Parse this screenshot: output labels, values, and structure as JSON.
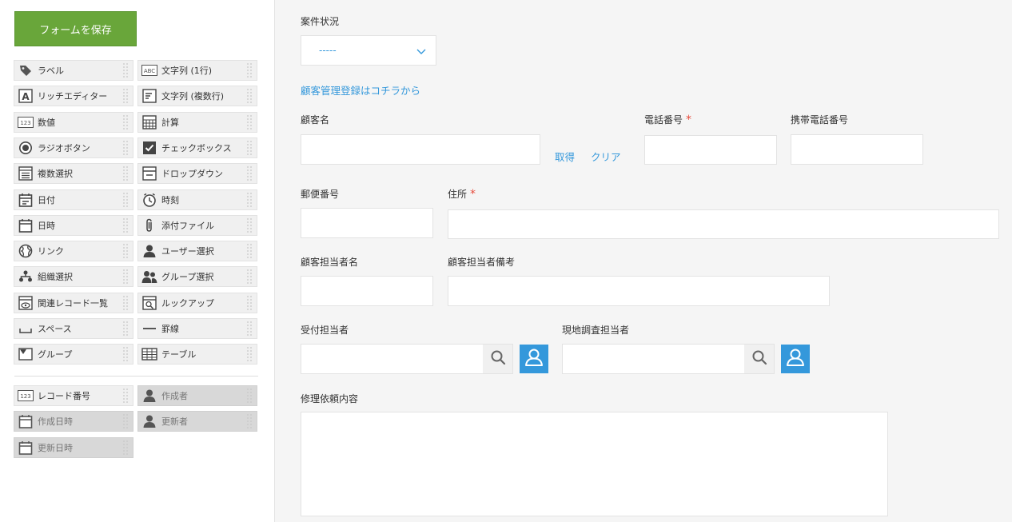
{
  "palette": {
    "save_label": "フォームを保存",
    "items": [
      {
        "label": "ラベル",
        "icon": "tag-icon"
      },
      {
        "label": "文字列 (1行)",
        "icon": "abc-text-icon"
      },
      {
        "label": "リッチエディター",
        "icon": "rich-editor-icon"
      },
      {
        "label": "文字列 (複数行)",
        "icon": "multiline-text-icon"
      },
      {
        "label": "数値",
        "icon": "number-icon"
      },
      {
        "label": "計算",
        "icon": "calculator-icon"
      },
      {
        "label": "ラジオボタン",
        "icon": "radio-button-icon"
      },
      {
        "label": "チェックボックス",
        "icon": "checkbox-icon"
      },
      {
        "label": "複数選択",
        "icon": "multi-select-icon"
      },
      {
        "label": "ドロップダウン",
        "icon": "dropdown-icon"
      },
      {
        "label": "日付",
        "icon": "date-icon"
      },
      {
        "label": "時刻",
        "icon": "clock-icon"
      },
      {
        "label": "日時",
        "icon": "datetime-icon"
      },
      {
        "label": "添付ファイル",
        "icon": "paperclip-icon"
      },
      {
        "label": "リンク",
        "icon": "globe-icon"
      },
      {
        "label": "ユーザー選択",
        "icon": "user-icon"
      },
      {
        "label": "組織選択",
        "icon": "org-icon"
      },
      {
        "label": "グループ選択",
        "icon": "group-icon"
      },
      {
        "label": "関連レコード一覧",
        "icon": "related-records-icon"
      },
      {
        "label": "ルックアップ",
        "icon": "lookup-icon"
      },
      {
        "label": "スペース",
        "icon": "space-icon"
      },
      {
        "label": "罫線",
        "icon": "line-icon"
      },
      {
        "label": "グループ",
        "icon": "group-field-icon"
      },
      {
        "label": "テーブル",
        "icon": "table-icon"
      }
    ],
    "system_items": [
      {
        "label": "レコード番号",
        "icon": "record-number-icon",
        "disabled": false
      },
      {
        "label": "作成者",
        "icon": "creator-icon",
        "disabled": true
      },
      {
        "label": "作成日時",
        "icon": "created-datetime-icon",
        "disabled": true
      },
      {
        "label": "更新者",
        "icon": "updater-icon",
        "disabled": true
      },
      {
        "label": "更新日時",
        "icon": "updated-datetime-icon",
        "disabled": true
      }
    ]
  },
  "form": {
    "status_label": "案件状況",
    "status_value": "-----",
    "customer_link": "顧客管理登録はコチラから",
    "customer_name_label": "顧客名",
    "get_link": "取得",
    "clear_link": "クリア",
    "phone_label": "電話番号",
    "mobile_label": "携帯電話番号",
    "postal_label": "郵便番号",
    "address_label": "住所",
    "contact_name_label": "顧客担当者名",
    "contact_note_label": "顧客担当者備考",
    "receptionist_label": "受付担当者",
    "surveyor_label": "現地調査担当者",
    "repair_label": "修理依頼内容",
    "required_mark": "*"
  },
  "colors": {
    "accent": "#3498db",
    "save_button": "#69a63a",
    "required": "#e74c3c"
  }
}
